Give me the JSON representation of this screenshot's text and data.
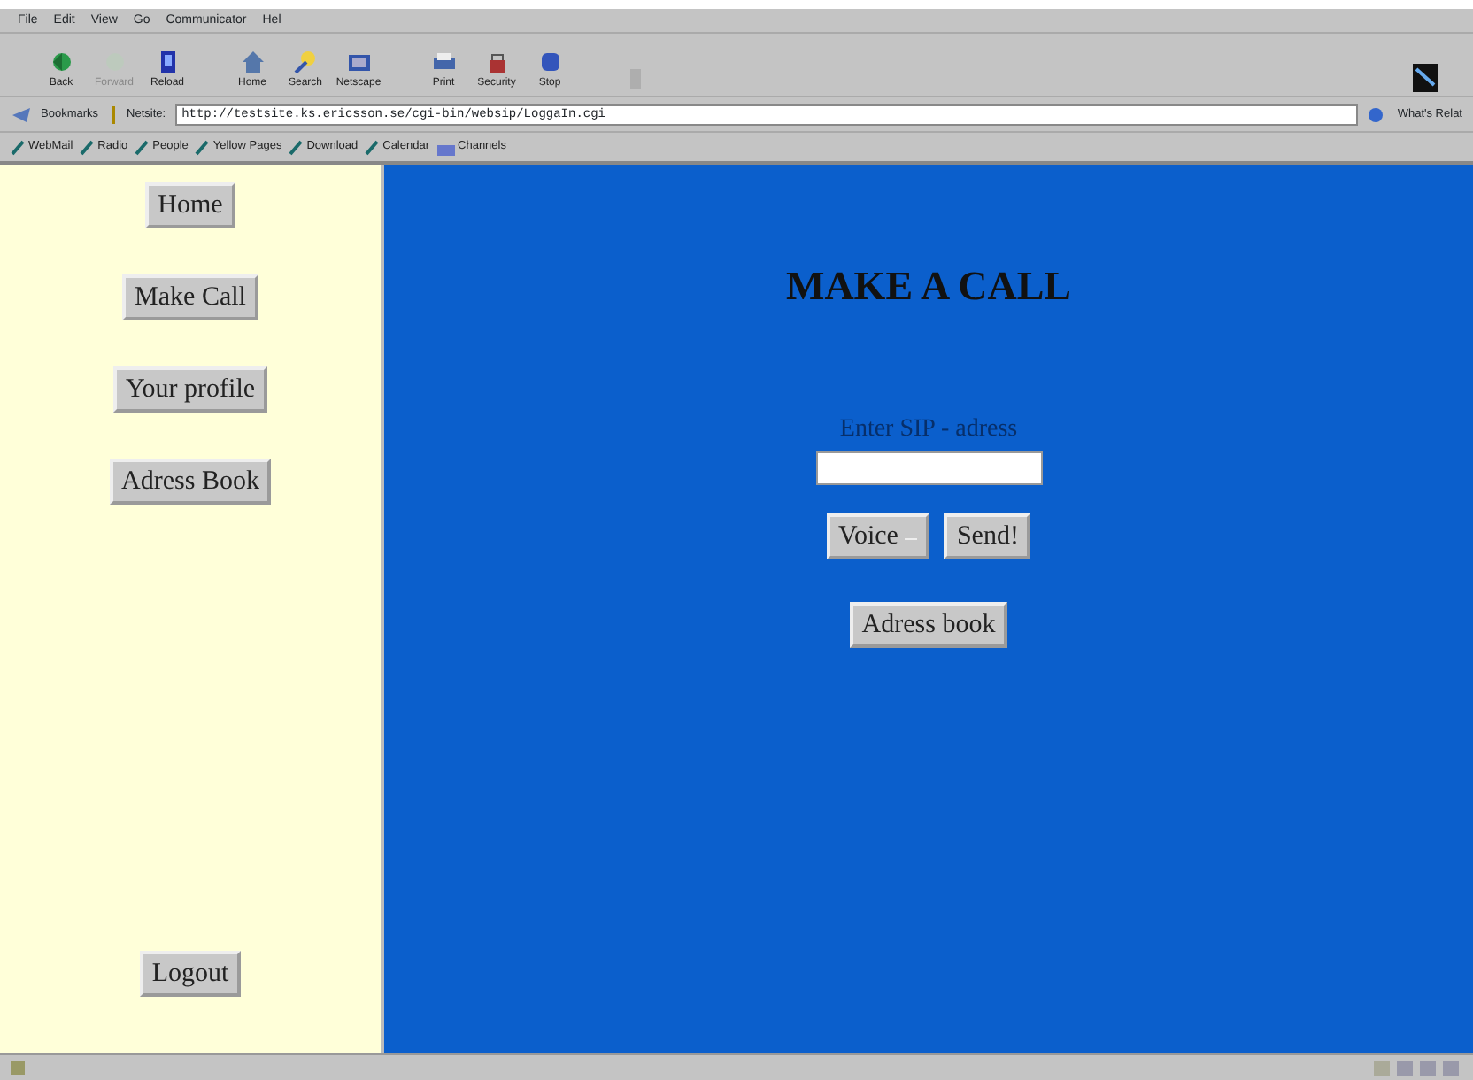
{
  "menu": [
    "File",
    "Edit",
    "View",
    "Go",
    "Communicator",
    "Hel"
  ],
  "toolbar": [
    {
      "label": "Back",
      "kind": "back",
      "disabled": false
    },
    {
      "label": "Forward",
      "kind": "forward",
      "disabled": true
    },
    {
      "label": "Reload",
      "kind": "reload",
      "disabled": false
    },
    {
      "label": "Home",
      "kind": "home",
      "disabled": false
    },
    {
      "label": "Search",
      "kind": "search",
      "disabled": false
    },
    {
      "label": "Netscape",
      "kind": "netscape",
      "disabled": false
    },
    {
      "label": "Print",
      "kind": "print",
      "disabled": false
    },
    {
      "label": "Security",
      "kind": "security",
      "disabled": false
    },
    {
      "label": "Stop",
      "kind": "stop",
      "disabled": false
    },
    {
      "kind": "shop",
      "disabled": true
    }
  ],
  "location": {
    "bookmarks": "Bookmarks",
    "label": "Netsite:",
    "url": "http://testsite.ks.ericsson.se/cgi-bin/websip/LoggaIn.cgi",
    "related": "What's Relat"
  },
  "personal_toolbar": [
    {
      "label": "WebMail",
      "kind": "link"
    },
    {
      "label": "Radio",
      "kind": "link"
    },
    {
      "label": "People",
      "kind": "link"
    },
    {
      "label": "Yellow Pages",
      "kind": "link"
    },
    {
      "label": "Download",
      "kind": "link"
    },
    {
      "label": "Calendar",
      "kind": "link"
    },
    {
      "label": "Channels",
      "kind": "channels"
    }
  ],
  "sidebar": {
    "items": [
      "Home",
      "Make Call",
      "Your profile",
      "Adress Book"
    ],
    "logout": "Logout"
  },
  "main": {
    "title": "MAKE A CALL",
    "field_label": "Enter SIP - adress",
    "call_type": "Voice",
    "send": "Send!",
    "address_book": "Adress book"
  }
}
